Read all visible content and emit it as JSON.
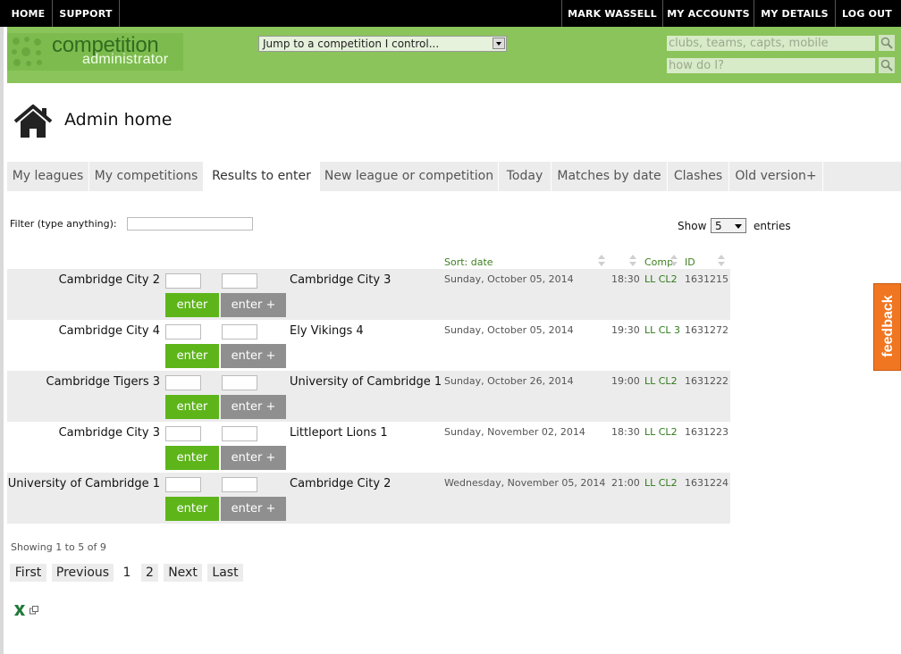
{
  "topnav": {
    "home": "HOME",
    "support": "SUPPORT",
    "user": "MARK WASSELL",
    "accounts": "MY ACCOUNTS",
    "details": "MY DETAILS",
    "logout": "LOG OUT"
  },
  "header": {
    "logo_line1": "competition",
    "logo_line2": "administrator",
    "jump_label": "Jump to a competition I control...",
    "search_placeholder": "clubs, teams, capts, mobile",
    "howto_placeholder": "how do I?"
  },
  "page": {
    "title": "Admin home"
  },
  "tabs": [
    {
      "label": "My leagues",
      "active": false
    },
    {
      "label": "My competitions",
      "active": false
    },
    {
      "label": "Results to enter",
      "active": true
    },
    {
      "label": "New league or competition",
      "active": false
    },
    {
      "label": "Today",
      "active": false
    },
    {
      "label": "Matches by date",
      "active": false
    },
    {
      "label": "Clashes",
      "active": false
    },
    {
      "label": "Old version+",
      "active": false
    }
  ],
  "filter": {
    "label": "Filter (type anything):"
  },
  "show": {
    "label": "Show",
    "value": "5",
    "suffix": "entries"
  },
  "table": {
    "headers": {
      "sort": "Sort: date",
      "comp": "Comp",
      "id": "ID"
    },
    "enter_label": "enter",
    "enter_plus_label": "enter +",
    "rows": [
      {
        "home": "Cambridge City 2",
        "away": "Cambridge City 3",
        "date": "Sunday, October 05, 2014",
        "time": "18:30",
        "comp": "LL CL2",
        "id": "1631215"
      },
      {
        "home": "Cambridge City 4",
        "away": "Ely Vikings 4",
        "date": "Sunday, October 05, 2014",
        "time": "19:30",
        "comp": "LL CL 3",
        "id": "1631272"
      },
      {
        "home": "Cambridge Tigers 3",
        "away": "University of Cambridge 1",
        "date": "Sunday, October 26, 2014",
        "time": "19:00",
        "comp": "LL CL2",
        "id": "1631222"
      },
      {
        "home": "Cambridge City 3",
        "away": "Littleport Lions 1",
        "date": "Sunday, November 02, 2014",
        "time": "18:30",
        "comp": "LL CL2",
        "id": "1631223"
      },
      {
        "home": "University of Cambridge 1",
        "away": "Cambridge City 2",
        "date": "Wednesday, November 05, 2014",
        "time": "21:00",
        "comp": "LL CL2",
        "id": "1631224"
      }
    ]
  },
  "pagination": {
    "info": "Showing 1 to 5 of 9",
    "first": "First",
    "previous": "Previous",
    "page1": "1",
    "page2": "2",
    "next": "Next",
    "last": "Last"
  },
  "feedback": {
    "label": "feedback"
  },
  "colors": {
    "green_header": "#8ac45a",
    "enter_green": "#5db51a",
    "feedback_orange": "#f07622"
  }
}
